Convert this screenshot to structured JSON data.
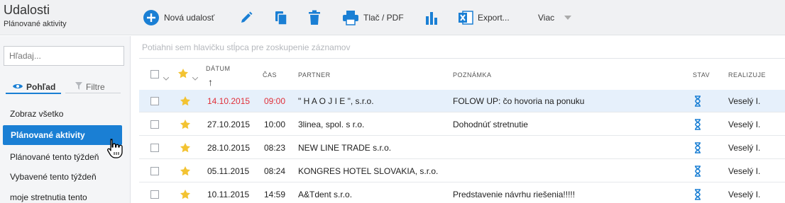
{
  "header": {
    "title": "Udalosti",
    "subtitle": "Plánované aktivity",
    "new_event_label": "Nová udalosť",
    "print_label": "Tlač / PDF",
    "export_label": "Export...",
    "more_label": "Viac"
  },
  "sidebar": {
    "search_placeholder": "Hľadaj...",
    "tab_view_label": "Pohľad",
    "tab_filters_label": "Filtre",
    "items": [
      {
        "label": "Zobraz všetko"
      },
      {
        "label": "Plánované aktivity"
      },
      {
        "label": "Plánované tento týždeň"
      },
      {
        "label": "Vybavené tento týždeň"
      },
      {
        "label": "moje stretnutia tento"
      }
    ]
  },
  "grid": {
    "group_hint": "Potiahni sem hlavičku stĺpca pre zoskupenie záznamov",
    "columns": {
      "date": "DÁTUM",
      "time": "ČAS",
      "partner": "PARTNER",
      "note": "POZNÁMKA",
      "status": "STAV",
      "realizes": "REALIZUJE"
    },
    "sort_arrow": "↑",
    "rows": [
      {
        "date": "14.10.2015",
        "time": "09:00",
        "partner": "\" H A O J I E \", s.r.o.",
        "note": "FOLOW UP: čo hovoria na ponuku",
        "realizes": "Veselý I."
      },
      {
        "date": "27.10.2015",
        "time": "10:00",
        "partner": "3linea, spol. s r.o.",
        "note": "Dohodnúť stretnutie",
        "realizes": "Veselý I."
      },
      {
        "date": "28.10.2015",
        "time": "08:23",
        "partner": "NEW LINE TRADE s.r.o.",
        "note": "",
        "realizes": "Veselý I."
      },
      {
        "date": "05.11.2015",
        "time": "08:24",
        "partner": "KONGRES HOTEL SLOVAKIA, s.r.o.",
        "note": "",
        "realizes": "Veselý I."
      },
      {
        "date": "10.11.2015",
        "time": "14:59",
        "partner": "A&Tdent s.r.o.",
        "note": "Predstavenie návrhu riešenia!!!!!",
        "realizes": "Veselý I."
      }
    ]
  },
  "colors": {
    "accent": "#1a7fd4",
    "overdue": "#e0303a",
    "star": "#f3c332",
    "selected_row": "#e6f0fb"
  }
}
